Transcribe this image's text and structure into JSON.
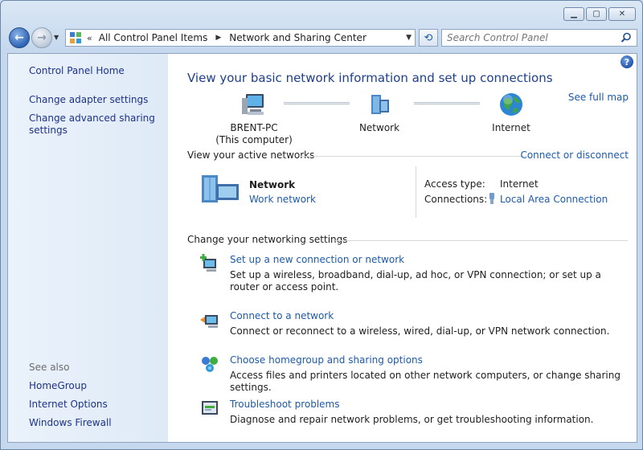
{
  "window": {
    "caption_min": "▁",
    "caption_max": "▢",
    "caption_close": "✕"
  },
  "nav": {
    "back_icon": "←",
    "forward_icon": "→",
    "recent_icon": "▼",
    "chevrons": "«",
    "breadcrumbs": [
      "All Control Panel Items",
      "Network and Sharing Center"
    ],
    "separator": "▶",
    "dropdown_icon": "▼",
    "refresh_icon": "⟲",
    "search_placeholder": "Search Control Panel"
  },
  "sidebar": {
    "home": "Control Panel Home",
    "links": [
      "Change adapter settings",
      "Change advanced sharing settings"
    ],
    "see_also_label": "See also",
    "see_also": [
      "HomeGroup",
      "Internet Options",
      "Windows Firewall"
    ]
  },
  "main": {
    "help": "?",
    "title": "View your basic network information and set up connections",
    "see_full_map": "See full map",
    "map": {
      "computer": "BRENT-PC",
      "computer_sub": "(This computer)",
      "network": "Network",
      "internet": "Internet"
    },
    "active": {
      "header": "View your active networks",
      "connect_link": "Connect or disconnect",
      "network_name": "Network",
      "network_type": "Work network",
      "access_type_label": "Access type:",
      "access_type_value": "Internet",
      "connections_label": "Connections:",
      "connections_value": "Local Area Connection"
    },
    "settings": {
      "header": "Change your networking settings",
      "tasks": [
        {
          "link": "Set up a new connection or network",
          "desc": "Set up a wireless, broadband, dial-up, ad hoc, or VPN connection; or set up a router or access point."
        },
        {
          "link": "Connect to a network",
          "desc": "Connect or reconnect to a wireless, wired, dial-up, or VPN network connection."
        },
        {
          "link": "Choose homegroup and sharing options",
          "desc": "Access files and printers located on other network computers, or change sharing settings."
        },
        {
          "link": "Troubleshoot problems",
          "desc": "Diagnose and repair network problems, or get troubleshooting information."
        }
      ]
    }
  },
  "colors": {
    "link": "#1e5aa8",
    "title": "#1e3f8a",
    "sidebar_link": "#1e3287"
  }
}
